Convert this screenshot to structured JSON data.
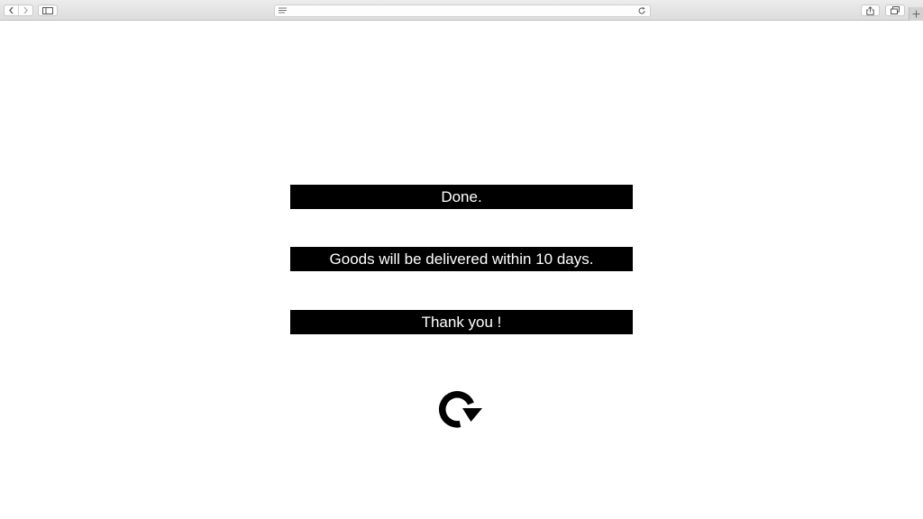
{
  "browser": {
    "back_icon": "chevron-left-icon",
    "forward_icon": "chevron-right-icon",
    "sidebar_icon": "sidebar-icon",
    "reader_icon": "reader-lines-icon",
    "reload_icon": "reload-icon",
    "share_icon": "share-icon",
    "tabs_icon": "tabs-icon",
    "new_tab_icon": "plus-icon",
    "address_value": ""
  },
  "main": {
    "status_text": "Done.",
    "delivery_text": "Goods will be delivered within 10 days.",
    "thanks_text": "Thank you !",
    "restart_icon": "circular-arrow-icon"
  },
  "colors": {
    "banner_bg": "#000000",
    "banner_text": "#ffffff",
    "page_bg": "#ffffff"
  }
}
